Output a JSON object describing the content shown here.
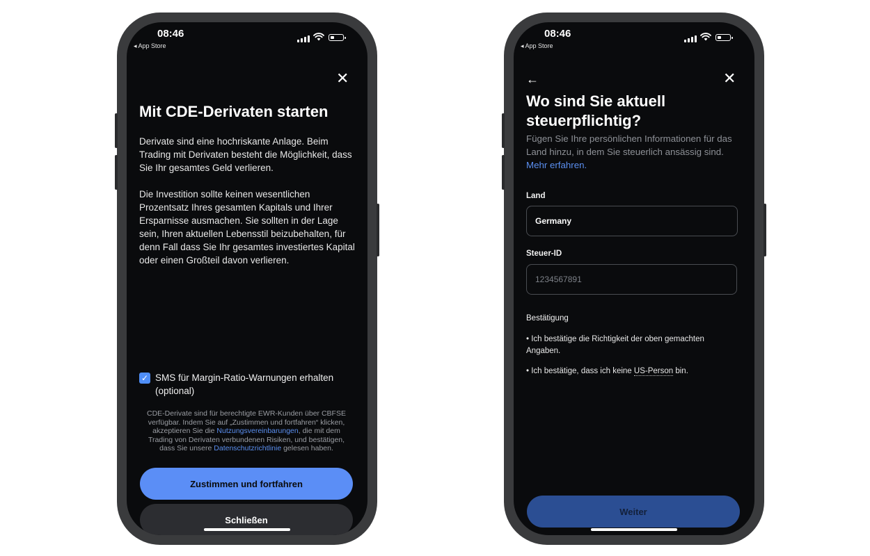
{
  "status_bar": {
    "time": "08:46",
    "back_app": "◂ App Store"
  },
  "left_screen": {
    "title": "Mit CDE-Derivaten starten",
    "paragraph1": "Derivate sind eine hochriskante Anlage. Beim Trading mit Derivaten besteht die Möglichkeit, dass Sie Ihr gesamtes Geld verlieren.",
    "paragraph2": "Die Investition sollte keinen wesentlichen Prozentsatz Ihres gesamten Kapitals und Ihrer Ersparnisse ausmachen. Sie sollten in der Lage sein, Ihren aktuellen Lebensstil beizubehalten, für denn Fall dass Sie Ihr gesamtes investiertes Kapital oder einen Großteil davon verlieren.",
    "checkbox_label": "SMS für Margin-Ratio-Warnungen erhalten (optional)",
    "checkbox_checked": true,
    "legal_part1": "CDE-Derivate sind für berechtigte EWR-Kunden über CBFSE verfügbar. Indem Sie auf „Zustimmen und fortfahren“ klicken, akzeptieren Sie die",
    "legal_link1": "Nutzungsvereinbarungen",
    "legal_part2": ", die mit dem Trading von Derivaten verbundenen Risiken, und bestätigen, dass Sie unsere",
    "legal_link2": "Datenschutzrichtlinie",
    "legal_part3": "gelesen haben.",
    "primary_button": "Zustimmen und fortfahren",
    "secondary_button": "Schließen"
  },
  "right_screen": {
    "title_line1": "Wo sind Sie aktuell",
    "title_line2": "steuerpflichtig?",
    "subtitle": "Fügen Sie Ihre persönlichen Informationen für das Land hinzu, in dem Sie steuerlich ansässig sind.",
    "more_link": "Mehr erfahren.",
    "country_label": "Land",
    "country_value": "Germany",
    "taxid_label": "Steuer-ID",
    "taxid_placeholder": "1234567891",
    "confirm_label": "Bestätigung",
    "bullet1": "• Ich bestätige die Richtigkeit der oben gemachten Angaben.",
    "bullet2_prefix": "• Ich bestätige, dass ich keine",
    "bullet2_link": "US-Person",
    "bullet2_suffix": "bin.",
    "button": "Weiter"
  },
  "colors": {
    "accent": "#5b8ef6",
    "screen_bg": "#0a0b0d",
    "frame": "#3a3b3d",
    "muted_text": "#8e9197",
    "disabled_button": "#2b4e93"
  }
}
